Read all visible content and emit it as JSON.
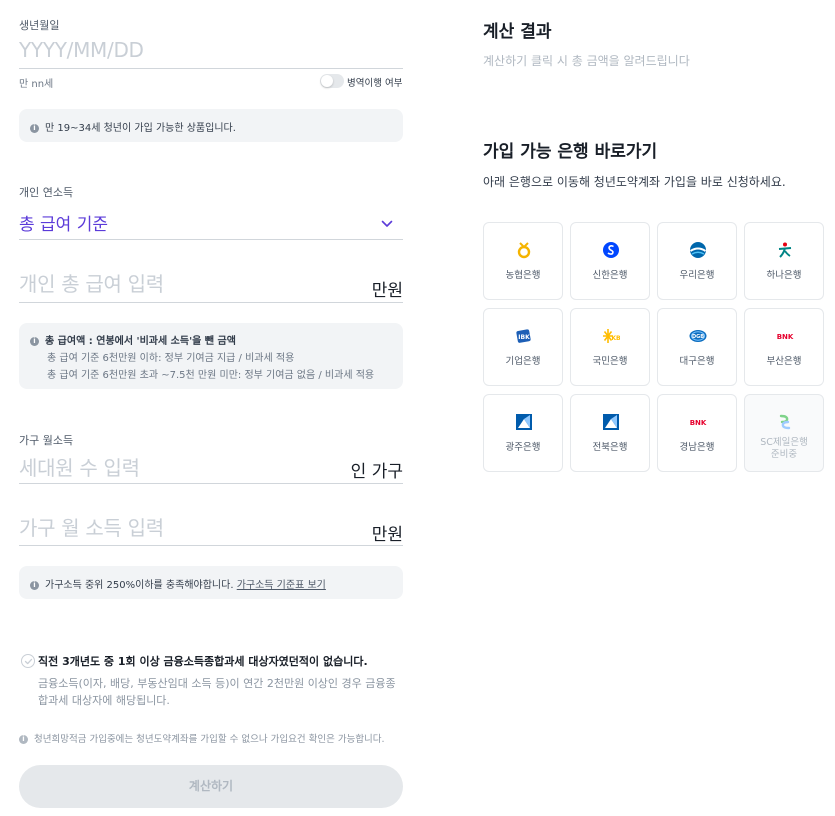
{
  "birth": {
    "label": "생년월일",
    "placeholder": "YYYY/MM/DD",
    "age_text": "만 nn세",
    "military_toggle_label": "병역이행 여부",
    "notice": "만 19~34세 청년이 가입 가능한 상품입니다."
  },
  "income": {
    "label": "개인 연소득",
    "select_value": "총 급여 기준",
    "input_placeholder": "개인 총 급여 입력",
    "unit": "만원",
    "notice_title": "총 급여액 : 연봉에서 '비과세 소득'을 뺀 금액",
    "notice_line1": "총 급여 기준 6천만원 이하: 정부 기여금 지급 / 비과세 적용",
    "notice_line2": "총 급여 기준 6천만원 초과 ~7.5천 만원 미만: 정부 기여금 없음 / 비과세 적용"
  },
  "household": {
    "label": "가구 월소득",
    "members_placeholder": "세대원 수 입력",
    "members_unit": "인 가구",
    "income_placeholder": "가구 월 소득 입력",
    "income_unit": "만원",
    "notice": "가구소득 중위 250%이하를 충족해야합니다.",
    "notice_link": "가구소득 기준표 보기"
  },
  "tax": {
    "check_label": "직전 3개년도 중 1회 이상 금융소득종합과세 대상자였던적이 없습니다.",
    "desc_line1": "금융소득(이자, 배당, 부동산임대 소득 등)이 연간 2천만원 이상인 경우 금융종",
    "desc_line2": "합과세 대상자에 해당됩니다."
  },
  "footer_notice": "청년희망적금 가입중에는 청년도약계좌를 가입할 수 없으나 가입요건 확인은 가능합니다.",
  "calc_button": "계산하기",
  "result": {
    "title": "계산 결과",
    "subtitle": "계산하기 클릭 시 총 금액을 알려드립니다"
  },
  "banks_section": {
    "title": "가입 가능 은행 바로가기",
    "subtitle": "아래 은행으로 이동해 청년도약계좌 가입을 바로 신청하세요.",
    "banks": [
      {
        "name": "농협은행",
        "icon": "nh-logo-icon",
        "color": "#f5b400"
      },
      {
        "name": "신한은행",
        "icon": "shinhan-logo-icon",
        "color": "#0046ff"
      },
      {
        "name": "우리은행",
        "icon": "woori-logo-icon",
        "color": "#0067ac"
      },
      {
        "name": "하나은행",
        "icon": "hana-logo-icon",
        "color": "#008485"
      },
      {
        "name": "기업은행",
        "icon": "ibk-logo-icon",
        "color": "#1d5fb6"
      },
      {
        "name": "국민은행",
        "icon": "kb-logo-icon",
        "color": "#ffbc00"
      },
      {
        "name": "대구은행",
        "icon": "dgb-logo-icon",
        "color": "#0c6dbf"
      },
      {
        "name": "부산은행",
        "icon": "bnk-logo-icon",
        "color": "#e6002d"
      },
      {
        "name": "광주은행",
        "icon": "kjb-logo-icon",
        "color": "#005bac"
      },
      {
        "name": "전북은행",
        "icon": "jb-logo-icon",
        "color": "#005bac"
      },
      {
        "name": "경남은행",
        "icon": "bnk-logo-icon",
        "color": "#e6002d"
      },
      {
        "name": "SC제일은행",
        "name2": "준비중",
        "icon": "sc-logo-icon",
        "color": "#38b44a"
      }
    ]
  }
}
